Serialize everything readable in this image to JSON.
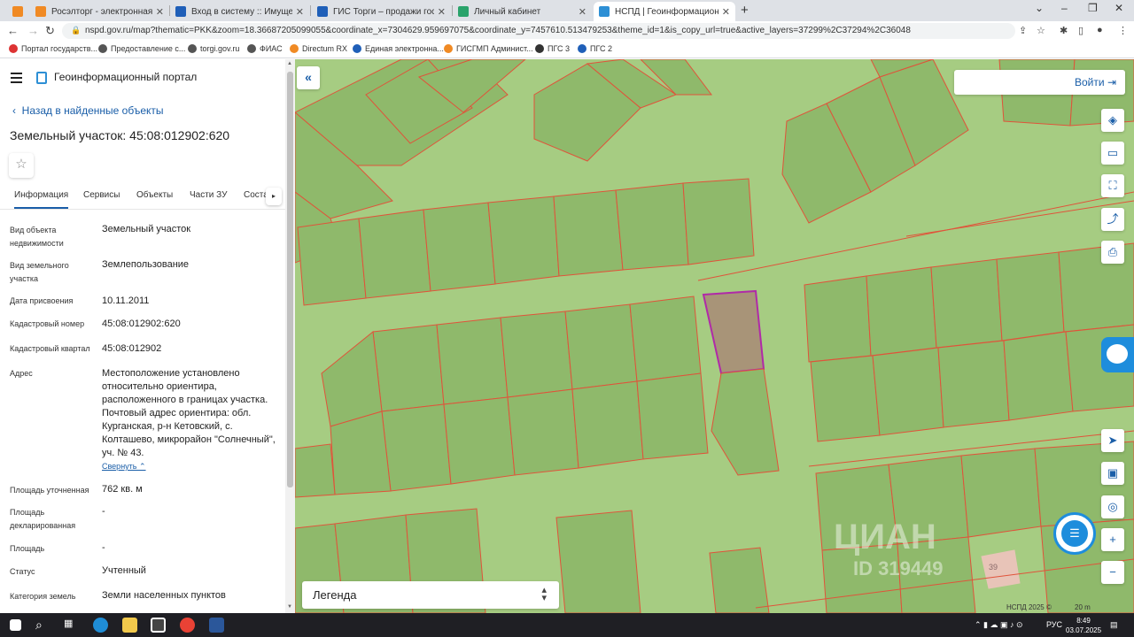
{
  "browser": {
    "tabs": [
      {
        "title": "Росэлторг - электронная торговл",
        "color": "#f08a24"
      },
      {
        "title": "Вход в систему :: Имущественн",
        "color": "#1f5fb8"
      },
      {
        "title": "ГИС Торги – продажи государст",
        "color": "#1f5fb8"
      },
      {
        "title": "Личный кабинет",
        "color": "#2aa36b"
      },
      {
        "title": "НСПД | Геоинформационный п",
        "color": "#2d8fd5"
      }
    ],
    "url": "nspd.gov.ru/map?thematic=PKK&zoom=18.36687205099055&coordinate_x=7304629.959697075&coordinate_y=7457610.513479253&theme_id=1&is_copy_url=true&active_layers=37299%2C37294%2C36048",
    "bookmarks": [
      {
        "label": "Портал государств...",
        "color": "#d33"
      },
      {
        "label": "Предоставление с...",
        "color": "#555"
      },
      {
        "label": "torgi.gov.ru",
        "color": "#555"
      },
      {
        "label": "ФИАС",
        "color": "#555"
      },
      {
        "label": "Directum RX",
        "color": "#f08a24"
      },
      {
        "label": "Единая электронна...",
        "color": "#1f5fb8"
      },
      {
        "label": "ГИСГМП Админист...",
        "color": "#f08a24"
      },
      {
        "label": "ПГС 3",
        "color": "#333"
      },
      {
        "label": "ПГС 2",
        "color": "#1f5fb8"
      }
    ]
  },
  "panel": {
    "portal_title": "Геоинформационный портал",
    "back_link": "Назад в найденные объекты",
    "object_title": "Земельный участок: 45:08:012902:620",
    "tabs": [
      "Информация",
      "Сервисы",
      "Объекты",
      "Части ЗУ",
      "Соста"
    ],
    "fields": [
      {
        "label": "Вид объекта недвижимости",
        "value": "Земельный участок"
      },
      {
        "label": "Вид земельного участка",
        "value": "Землепользование"
      },
      {
        "label": "Дата присвоения",
        "value": "10.11.2011"
      },
      {
        "label": "Кадастровый номер",
        "value": "45:08:012902:620"
      },
      {
        "label": "Кадастровый квартал",
        "value": "45:08:012902"
      },
      {
        "label": "Адрес",
        "value": "Местоположение установлено относительно ориентира, расположенного в границах участка. Почтовый адрес ориентира: обл. Курганская, р-н Кетовский, с. Колташево, микрорайон \"Солнечный\", уч. № 43."
      },
      {
        "label": "Площадь уточненная",
        "value": "762 кв. м"
      },
      {
        "label": "Площадь декларированная",
        "value": "-"
      },
      {
        "label": "Площадь",
        "value": "-"
      },
      {
        "label": "Статус",
        "value": "Учтенный"
      },
      {
        "label": "Категория земель",
        "value": "Земли населенных пунктов"
      }
    ],
    "collapse_label": "Свернуть"
  },
  "map": {
    "login_label": "Войти",
    "legend_label": "Легенда",
    "watermark": "ЦИАН",
    "watermark_id": "ID 319449",
    "copyright": "НСПД 2025 ©",
    "scale": "20 m",
    "lot_label": "39",
    "colors": {
      "bg": "#a6cc82",
      "parcel": "#8fb96b",
      "border": "#e0533a",
      "selected": "#b02aa8"
    }
  },
  "taskbar": {
    "language": "РУС",
    "time": "8:49",
    "date": "03.07.2025"
  }
}
